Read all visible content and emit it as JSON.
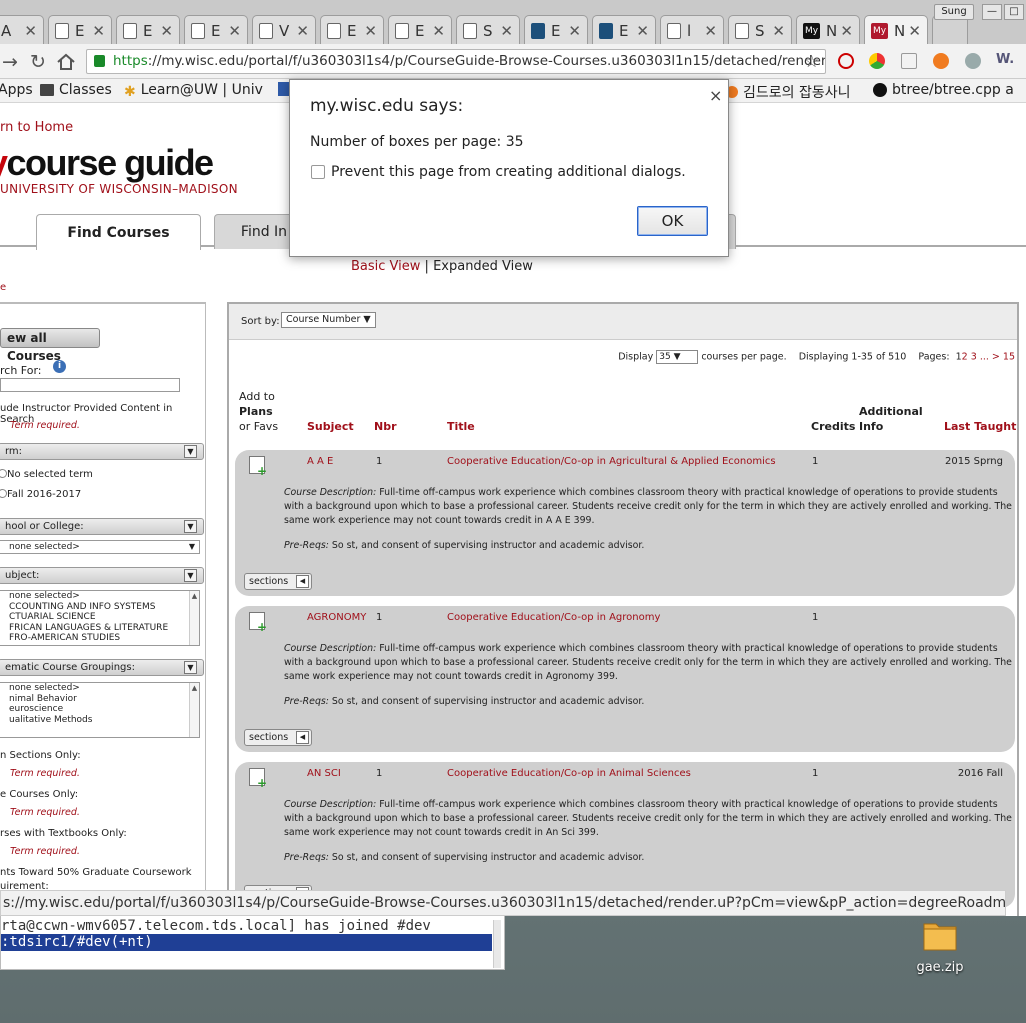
{
  "browser": {
    "tabs": [
      {
        "label": "A",
        "icon": "page-icon"
      },
      {
        "label": "E",
        "icon": "page-icon"
      },
      {
        "label": "E",
        "icon": "page-icon"
      },
      {
        "label": "E",
        "icon": "page-icon"
      },
      {
        "label": "V",
        "icon": "page-icon"
      },
      {
        "label": "E",
        "icon": "page-icon"
      },
      {
        "label": "E",
        "icon": "page-icon"
      },
      {
        "label": "S",
        "icon": "page-icon"
      },
      {
        "label": "E",
        "icon": "cross-icon"
      },
      {
        "label": "E",
        "icon": "cross-icon"
      },
      {
        "label": "l",
        "icon": "page-icon"
      },
      {
        "label": "S",
        "icon": "page-icon"
      },
      {
        "label": "N",
        "icon": "my-icon"
      },
      {
        "label": "N",
        "icon": "my-icon",
        "active": true
      }
    ],
    "favicon_text": "My",
    "user_button": "Sung",
    "url_scheme": "https",
    "url_rest": "://my.wisc.edu/portal/f/u360303l1s4/p/CourseGuide-Browse-Courses.u360303l1n15/detached/render",
    "bookmarks": [
      "Apps",
      "Classes",
      "Learn@UW | Univ",
      "김드로의 잡동사니",
      "btree/btree.cpp a"
    ],
    "status_url": "s://my.wisc.edu/portal/f/u360303l1s4/p/CourseGuide-Browse-Courses.u360303l1n15/detached/render.uP?pCm=view&pP_action=degreeRoadmaps"
  },
  "page": {
    "return_home": "rn to Home",
    "logo_my": "y",
    "logo_rest": "course guide",
    "logo_sub": "UNIVERSITY OF WISCONSIN–MADISON",
    "tabs": [
      "Find Courses",
      "Find In"
    ],
    "view_basic": "Basic View",
    "view_sep": " | ",
    "view_expanded": "Expanded View",
    "red_e": "e"
  },
  "sidebar": {
    "view_all": "ew all Courses",
    "search_for": "rch For:",
    "include_instructor": "ude Instructor Provided Content in Search",
    "term_required": "Term required.",
    "term_header": "rm:",
    "term_options": [
      "No selected term",
      "Fall 2016-2017"
    ],
    "school_header": "hool or College:",
    "school_value": "none selected>",
    "subject_header": "ubject:",
    "subject_items": [
      "none selected>",
      "CCOUNTING AND INFO SYSTEMS",
      "CTUARIAL SCIENCE",
      "FRICAN LANGUAGES & LITERATURE",
      "FRO-AMERICAN STUDIES"
    ],
    "thematic_header": "ematic Course Groupings:",
    "thematic_items": [
      "none selected>",
      "nimal Behavior",
      "euroscience",
      "ualitative Methods"
    ],
    "open_sections": "n Sections Only:",
    "courses_only": "e Courses Only:",
    "textbooks_only": "rses with Textbooks Only:",
    "grad_coursework": "nts Toward 50% Graduate Coursework",
    "requirement": "uirement:"
  },
  "results": {
    "sort_by": "Sort by:",
    "sort_value": "Course Number",
    "display_label": "Display",
    "per_page_value": "35",
    "per_page_suffix": "courses per page.",
    "displaying": "Displaying 1-35 of 510",
    "pages_label": "Pages:",
    "pages": [
      "1",
      "2",
      "3",
      "...",
      ">",
      "15"
    ],
    "headers": {
      "add_to": "Add to",
      "plans": "Plans",
      "or_favs": "or Favs",
      "subject": "Subject",
      "nbr": "Nbr",
      "title": "Title",
      "credits": "Credits",
      "additional": "Additional",
      "info": "Info",
      "last_taught": "Last Taught"
    },
    "desc_label": "Course Description:",
    "prereq_label": "Pre-Reqs:",
    "sections_label": "sections",
    "courses": [
      {
        "subject": "A A E",
        "nbr": "1",
        "title": "Cooperative Education/Co-op in Agricultural & Applied Economics",
        "credits": "1",
        "last_taught": "2015 Sprng",
        "description": "Full-time off-campus work experience which combines classroom theory with practical knowledge of operations to provide students with a background upon which to base a professional career. Students receive credit only for the term in which they are actively enrolled and working. The same work experience may not count towards credit in A A E 399.",
        "prereqs": "So st, and consent of supervising instructor and academic advisor."
      },
      {
        "subject": "AGRONOMY",
        "nbr": "1",
        "title": "Cooperative Education/Co-op in Agronomy",
        "credits": "1",
        "last_taught": "",
        "description": "Full-time off-campus work experience which combines classroom theory with practical knowledge of operations to provide students with a background upon which to base a professional career. Students receive credit only for the term in which they are actively enrolled and working. The same work experience may not count towards credit in Agronomy 399.",
        "prereqs": "So st, and consent of supervising instructor and academic advisor."
      },
      {
        "subject": "AN SCI",
        "nbr": "1",
        "title": "Cooperative Education/Co-op in Animal Sciences",
        "credits": "1",
        "last_taught": "2016 Fall",
        "description": "Full-time off-campus work experience which combines classroom theory with practical knowledge of operations to provide students with a background upon which to base a professional career. Students receive credit only for the term in which they are actively enrolled and working. The same work experience may not count towards credit in An Sci 399.",
        "prereqs": "So st, and consent of supervising instructor and academic advisor."
      }
    ]
  },
  "dialog": {
    "title": "my.wisc.edu says:",
    "message": "Number of boxes per page: 35",
    "checkbox_label": "Prevent this page from creating additional dialogs.",
    "ok": "OK",
    "close": "×"
  },
  "desktop": {
    "term_line1": "rta@ccwn-wmv6057.telecom.tds.local] has joined #dev",
    "term_line2": ":tdsirc1/#dev(+nt)",
    "zip_label": "gae.zip"
  },
  "colors": {
    "uw_red": "#c5050c",
    "link_red": "#a0101a",
    "course_card": "#cfcfcf",
    "terminal_highlight": "#1f3f95"
  }
}
